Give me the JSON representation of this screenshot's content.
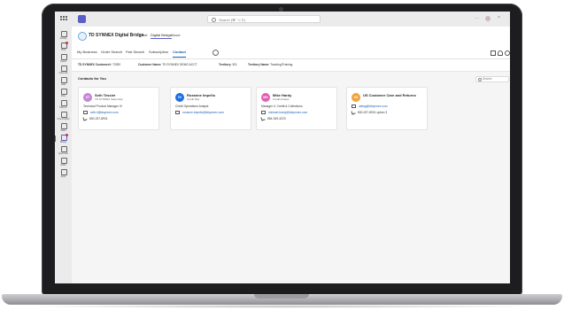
{
  "search": {
    "placeholder": "Search (⌘ ⌥ E)"
  },
  "rail": [
    {
      "label": "Activity",
      "badge": false,
      "active": false
    },
    {
      "label": "Chat",
      "badge": true,
      "active": false
    },
    {
      "label": "Teams",
      "badge": false,
      "active": false
    },
    {
      "label": "Calendar",
      "badge": false,
      "active": false
    },
    {
      "label": "Calls",
      "badge": false,
      "active": false
    },
    {
      "label": "Files",
      "badge": false,
      "active": false
    },
    {
      "label": "Planner",
      "badge": false,
      "active": false
    },
    {
      "label": "Viva Insights",
      "badge": false,
      "active": false
    },
    {
      "label": "Tasks",
      "badge": false,
      "active": false
    },
    {
      "label": "Bridge",
      "badge": true,
      "active": true
    },
    {
      "label": "Approvals",
      "badge": false,
      "active": false
    },
    {
      "label": "Shifts",
      "badge": false,
      "active": false
    },
    {
      "label": "Apps",
      "badge": false,
      "active": false
    }
  ],
  "app": {
    "title": "TD SYNNEX Digital Bridge",
    "header_links": [
      {
        "label": "Chat",
        "selected": false
      },
      {
        "label": "Digital Bridge",
        "selected": true
      },
      {
        "label": "About",
        "selected": false
      }
    ],
    "tabs": [
      {
        "label": "My Business",
        "active": false
      },
      {
        "label": "Order Search",
        "active": false
      },
      {
        "label": "Part Search",
        "active": false
      },
      {
        "label": "Subscription",
        "active": false
      },
      {
        "label": "Contact",
        "active": true
      }
    ]
  },
  "info": {
    "customer_label": "TD SYNNEX Customer#:",
    "customer_value": "70392",
    "name_label": "Customer Name:",
    "name_value": "TD SYNNEX DEMO ACCT",
    "territory_label": "Territory:",
    "territory_value": "301",
    "territory_name_label": "Territory Name:",
    "territory_name_value": "Tracking/Training"
  },
  "contacts": {
    "title": "Contacts for You",
    "search_placeholder": "Search",
    "cards": [
      {
        "initials": "ST",
        "name": "Seth Tessier",
        "role": "TD SYNNEX Sales Rep",
        "desc": "Technical Product Manager III",
        "email": "seth.t@tdsynnex.com",
        "phone": "800-237-8931",
        "color": "#c586d6"
      },
      {
        "initials": "RI",
        "name": "Roxanne Impello",
        "role": "Credit Rep",
        "desc": "Credit Operations Analyst",
        "email": "roxanne.impello@tdsynnex.com",
        "phone": "",
        "color": "#1f6fe0"
      },
      {
        "initials": "MH",
        "name": "Mike Hardy",
        "role": "Credit Analyst",
        "desc": "Manager II, Credit & Collections",
        "email": "michael.hardy@tdsynnex.com",
        "phone": "864-349-4223",
        "color": "#e05fb4"
      },
      {
        "initials": "US",
        "name": "US Customer Care and Returns",
        "role": "",
        "desc": "",
        "email": "usbsg@tdsynnex.com",
        "phone": "800-237-8931 option 3",
        "color": "#f0a23c"
      }
    ]
  }
}
